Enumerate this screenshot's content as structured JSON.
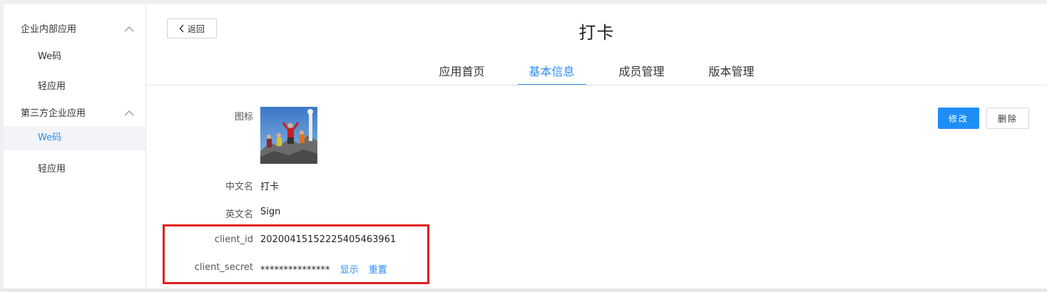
{
  "sidebar": {
    "groups": [
      {
        "label": "企业内部应用",
        "items": [
          {
            "label": "We码"
          },
          {
            "label": "轻应用"
          }
        ]
      },
      {
        "label": "第三方企业应用",
        "items": [
          {
            "label": "We码",
            "active": true
          },
          {
            "label": "轻应用"
          }
        ]
      }
    ]
  },
  "header": {
    "back_label": "返回",
    "title": "打卡"
  },
  "tabs": [
    {
      "label": "应用首页"
    },
    {
      "label": "基本信息",
      "active": true
    },
    {
      "label": "成员管理"
    },
    {
      "label": "版本管理"
    }
  ],
  "form": {
    "icon_label": "图标",
    "cn_name_label": "中文名",
    "cn_name_value": "打卡",
    "en_name_label": "英文名",
    "en_name_value": "Sign",
    "client_id_label": "client_id",
    "client_id_value": "20200415152225405463961",
    "client_secret_label": "client_secret",
    "client_secret_value": "***************",
    "show_link": "显示",
    "reset_link": "重置"
  },
  "actions": {
    "edit_label": "修改",
    "delete_label": "删除"
  },
  "colors": {
    "accent": "#2d8cf0",
    "primary_button": "#1e8ef7",
    "highlight_box": "#e02020"
  }
}
